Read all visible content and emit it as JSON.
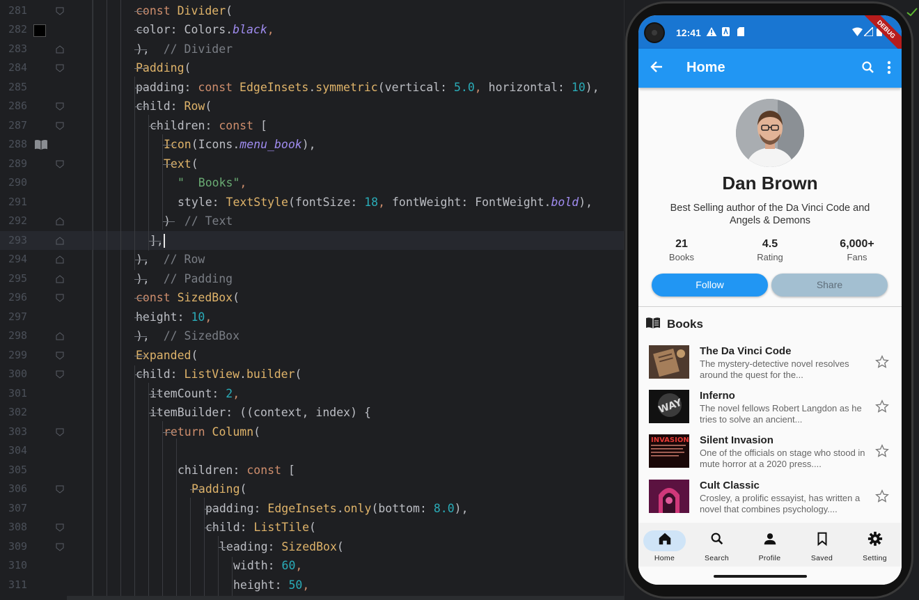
{
  "editor": {
    "lines": [
      {
        "n": "281",
        "indent": 0,
        "tokens": [
          [
            "kw",
            "const "
          ],
          [
            "cls",
            "Divider"
          ],
          [
            "",
            "("
          ]
        ]
      },
      {
        "n": "282",
        "indent": 1,
        "tokens": [
          [
            "",
            "color: Colors."
          ],
          [
            "ital",
            "black"
          ],
          [
            "kw",
            ","
          ]
        ]
      },
      {
        "n": "283",
        "indent": 0,
        "tokens": [
          [
            "",
            "),  "
          ],
          [
            "cmt",
            "// Divider"
          ]
        ]
      },
      {
        "n": "284",
        "indent": 0,
        "tokens": [
          [
            "cls",
            "Padding"
          ],
          [
            "",
            "("
          ]
        ]
      },
      {
        "n": "285",
        "indent": 1,
        "tokens": [
          [
            "",
            "padding: "
          ],
          [
            "kw",
            "const "
          ],
          [
            "cls",
            "EdgeInsets"
          ],
          [
            "",
            ". "
          ],
          [
            "fn",
            "symmetric"
          ],
          [
            "",
            "(vertical: "
          ],
          [
            "num",
            "5.0"
          ],
          [
            "kw",
            ", "
          ],
          [
            "",
            "horizontal: "
          ],
          [
            "num",
            "10"
          ],
          [
            "",
            "),"
          ]
        ]
      },
      {
        "n": "286",
        "indent": 1,
        "tokens": [
          [
            "",
            "child: "
          ],
          [
            "cls",
            "Row"
          ],
          [
            "",
            "("
          ]
        ]
      },
      {
        "n": "287",
        "indent": 2,
        "tokens": [
          [
            "",
            "children: "
          ],
          [
            "kw",
            "const "
          ],
          [
            "",
            "["
          ]
        ]
      },
      {
        "n": "288",
        "indent": 3,
        "tokens": [
          [
            "cls",
            "Icon"
          ],
          [
            "",
            "(Icons."
          ],
          [
            "ital",
            "menu_book"
          ],
          [
            "",
            "),"
          ]
        ]
      },
      {
        "n": "289",
        "indent": 3,
        "tokens": [
          [
            "cls",
            "Text"
          ],
          [
            "",
            "("
          ]
        ]
      },
      {
        "n": "290",
        "indent": 4,
        "tokens": [
          [
            "str",
            "\"  Books\""
          ],
          [
            "kw",
            ","
          ]
        ]
      },
      {
        "n": "291",
        "indent": 4,
        "tokens": [
          [
            "",
            "style: "
          ],
          [
            "cls",
            "TextStyle"
          ],
          [
            "",
            "(fontSize: "
          ],
          [
            "num",
            "18"
          ],
          [
            "kw",
            ", "
          ],
          [
            "",
            "fontWeight: FontWeight."
          ],
          [
            "ital",
            "bold"
          ],
          [
            "",
            "),"
          ]
        ]
      },
      {
        "n": "292",
        "indent": 3,
        "tokens": [
          [
            "",
            ")  "
          ],
          [
            "cmt",
            "// Text"
          ]
        ]
      },
      {
        "n": "293",
        "indent": 2,
        "tokens": [
          [
            "",
            "],"
          ]
        ],
        "caret": true
      },
      {
        "n": "294",
        "indent": 1,
        "tokens": [
          [
            "",
            "),  "
          ],
          [
            "cmt",
            "// Row"
          ]
        ]
      },
      {
        "n": "295",
        "indent": 0,
        "tokens": [
          [
            "",
            "),  "
          ],
          [
            "cmt",
            "// Padding"
          ]
        ]
      },
      {
        "n": "296",
        "indent": 0,
        "tokens": [
          [
            "kw",
            "const "
          ],
          [
            "cls",
            "SizedBox"
          ],
          [
            "",
            "("
          ]
        ]
      },
      {
        "n": "297",
        "indent": 1,
        "tokens": [
          [
            "",
            "height: "
          ],
          [
            "num",
            "10"
          ],
          [
            "kw",
            ","
          ]
        ]
      },
      {
        "n": "298",
        "indent": 0,
        "tokens": [
          [
            "",
            "),  "
          ],
          [
            "cmt",
            "// SizedBox"
          ]
        ]
      },
      {
        "n": "299",
        "indent": 0,
        "tokens": [
          [
            "cls",
            "Expanded"
          ],
          [
            "",
            "("
          ]
        ]
      },
      {
        "n": "300",
        "indent": 1,
        "tokens": [
          [
            "",
            "child: "
          ],
          [
            "cls",
            "ListView"
          ],
          [
            "",
            ". "
          ],
          [
            "fn",
            "builder"
          ],
          [
            "",
            "("
          ]
        ]
      },
      {
        "n": "301",
        "indent": 2,
        "tokens": [
          [
            "",
            "itemCount: "
          ],
          [
            "num",
            "2"
          ],
          [
            "kw",
            ","
          ]
        ]
      },
      {
        "n": "302",
        "indent": 2,
        "tokens": [
          [
            "",
            "itemBuilder: ((context, index) {"
          ]
        ]
      },
      {
        "n": "303",
        "indent": 3,
        "tokens": [
          [
            "kw",
            "return "
          ],
          [
            "cls",
            "Column"
          ],
          [
            "",
            "("
          ]
        ]
      },
      {
        "n": "304",
        "indent": 4,
        "tokens": []
      },
      {
        "n": "305",
        "indent": 4,
        "tokens": [
          [
            "",
            "children: "
          ],
          [
            "kw",
            "const "
          ],
          [
            "",
            "["
          ]
        ]
      },
      {
        "n": "306",
        "indent": 5,
        "tokens": [
          [
            "cls",
            "Padding"
          ],
          [
            "",
            "("
          ]
        ]
      },
      {
        "n": "307",
        "indent": 6,
        "tokens": [
          [
            "",
            "padding: "
          ],
          [
            "cls",
            "EdgeInsets"
          ],
          [
            "",
            ". "
          ],
          [
            "fn",
            "only"
          ],
          [
            "",
            "(bottom: "
          ],
          [
            "num",
            "8.0"
          ],
          [
            "",
            "),"
          ]
        ]
      },
      {
        "n": "308",
        "indent": 6,
        "tokens": [
          [
            "",
            "child: "
          ],
          [
            "cls",
            "ListTile"
          ],
          [
            "",
            "("
          ]
        ]
      },
      {
        "n": "309",
        "indent": 7,
        "tokens": [
          [
            "",
            "leading: "
          ],
          [
            "cls",
            "SizedBox"
          ],
          [
            "",
            "("
          ]
        ]
      },
      {
        "n": "310",
        "indent": 8,
        "tokens": [
          [
            "",
            "width: "
          ],
          [
            "num",
            "60"
          ],
          [
            "kw",
            ","
          ]
        ]
      },
      {
        "n": "311",
        "indent": 8,
        "tokens": [
          [
            "",
            "height: "
          ],
          [
            "num",
            "50"
          ],
          [
            "kw",
            ","
          ]
        ]
      }
    ]
  },
  "phone": {
    "status": {
      "time": "12:41",
      "debug": "DEBUG"
    },
    "appbar": {
      "title": "Home"
    },
    "profile": {
      "name": "Dan Brown",
      "bio": "Best Selling author of the Da Vinci Code and Angels & Demons",
      "stats": [
        {
          "value": "21",
          "label": "Books"
        },
        {
          "value": "4.5",
          "label": "Rating"
        },
        {
          "value": "6,000+",
          "label": "Fans"
        }
      ],
      "follow_label": "Follow",
      "share_label": "Share"
    },
    "books_section": {
      "title": "Books"
    },
    "books": [
      {
        "title": "The Da Vinci Code",
        "desc": "The mystery-detective novel resolves around the quest for the...",
        "cover_color": "#6b5040"
      },
      {
        "title": "Inferno",
        "desc": "The novel fellows Robert Langdon as he tries to solve an ancient...",
        "cover_color": "#1c1c1c"
      },
      {
        "title": "Silent Invasion",
        "desc": "One of the officials on stage who stood in mute horror at a 2020 press....",
        "cover_color": "#2a0b0b"
      },
      {
        "title": "Cult Classic",
        "desc": "Crosley, a prolific essayist, has written a novel that combines psychology....",
        "cover_color": "#7a1e4f"
      }
    ],
    "cover_text": {
      "inferno": "WAY",
      "silent_invasion": "INVASION"
    },
    "nav": [
      {
        "label": "Home",
        "icon": "home-icon",
        "active": true
      },
      {
        "label": "Search",
        "icon": "search-icon",
        "active": false
      },
      {
        "label": "Profile",
        "icon": "person-icon",
        "active": false
      },
      {
        "label": "Saved",
        "icon": "bookmark-icon",
        "active": false
      },
      {
        "label": "Setting",
        "icon": "gear-icon",
        "active": false
      }
    ],
    "colors": {
      "primary": "#2196f3",
      "status_bar": "#1976d2",
      "share": "#a3bfd1"
    }
  }
}
